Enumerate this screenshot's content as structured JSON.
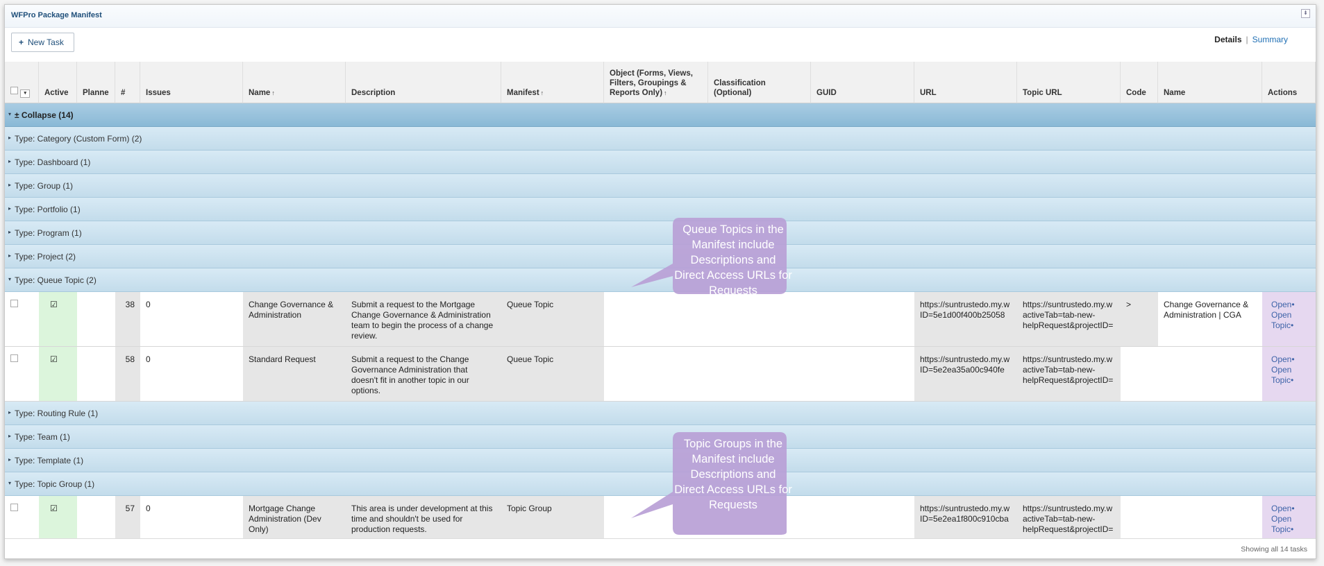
{
  "window": {
    "title": "WFPro Package Manifest",
    "collapse_glyph": "⇟"
  },
  "toolbar": {
    "new_task_icon": "plus-icon",
    "new_task_glyph": "+",
    "new_task_label": "New Task",
    "view_details": "Details",
    "view_separator": "|",
    "view_summary": "Summary"
  },
  "columns": {
    "active": "Active",
    "planned": "Planne",
    "number": "#",
    "issues": "Issues",
    "name": "Name",
    "description": "Description",
    "manifest": "Manifest",
    "object": "Object (Forms, Views, Filters, Groupings & Reports Only)",
    "classification": "Classification (Optional)",
    "guid": "GUID",
    "url": "URL",
    "topic_url": "Topic URL",
    "code": "Code",
    "name2": "Name",
    "actions": "Actions",
    "sort_glyph": "↑"
  },
  "groups": {
    "collapse_all": "± Collapse (14)",
    "category": "Type: Category (Custom Form) (2)",
    "dashboard": "Type: Dashboard (1)",
    "group": "Type: Group (1)",
    "portfolio": "Type: Portfolio (1)",
    "program": "Type: Program (1)",
    "project": "Type: Project (2)",
    "queue_topic": "Type: Queue Topic (2)",
    "routing_rule": "Type: Routing Rule (1)",
    "team": "Type: Team (1)",
    "template": "Type: Template (1)",
    "topic_group": "Type: Topic Group (1)",
    "expanded_glyph": "▾",
    "collapsed_glyph": "▸"
  },
  "rows": [
    {
      "active": "☑",
      "number": "38",
      "issues": "0",
      "name": "Change Governance & Administration",
      "description": "Submit a request to the Mortgage Change Governance & Administration team to begin the process of a change review.",
      "manifest": "Queue Topic",
      "url_line1": "https://suntrustedo.my.w",
      "url_line2": "ID=5e1d00f400b25058",
      "topic_url_line1": "https://suntrustedo.my.w",
      "topic_url_line2": "activeTab=tab-new-",
      "topic_url_line3": "helpRequest&projectID=",
      "code": ">",
      "name2": "Change Governance & Administration | CGA",
      "action1": "Open•",
      "action2": "Open",
      "action3": "Topic•"
    },
    {
      "active": "☑",
      "number": "58",
      "issues": "0",
      "name": "Standard Request",
      "description": "Submit a request to the Change Governance Administration that doesn't fit in another topic in our options.",
      "manifest": "Queue Topic",
      "url_line1": "https://suntrustedo.my.w",
      "url_line2": "ID=5e2ea35a00c940fe",
      "topic_url_line1": "https://suntrustedo.my.w",
      "topic_url_line2": "activeTab=tab-new-",
      "topic_url_line3": "helpRequest&projectID=",
      "code": "",
      "name2": "",
      "action1": "Open•",
      "action2": "Open",
      "action3": "Topic•"
    },
    {
      "active": "☑",
      "number": "57",
      "issues": "0",
      "name": "Mortgage Change Administration (Dev Only)",
      "description": "This area is under development at this time and shouldn't be used for production requests.",
      "manifest": "Topic Group",
      "url_line1": "https://suntrustedo.my.w",
      "url_line2": "ID=5e2ea1f800c910cba",
      "topic_url_line1": "https://suntrustedo.my.w",
      "topic_url_line2": "activeTab=tab-new-",
      "topic_url_line3": "helpRequest&projectID=",
      "code": "",
      "name2": "",
      "action1": "Open•",
      "action2": "Open",
      "action3": "Topic•"
    }
  ],
  "callouts": {
    "queue_topics": "Queue Topics in the Manifest include Descriptions and Direct Access URLs for Requests",
    "topic_groups": "Topic Groups in the Manifest include Descriptions and Direct Access URLs for Requests",
    "color": "#b89fd6"
  },
  "footer": {
    "count_text": "Showing all 14 tasks"
  }
}
